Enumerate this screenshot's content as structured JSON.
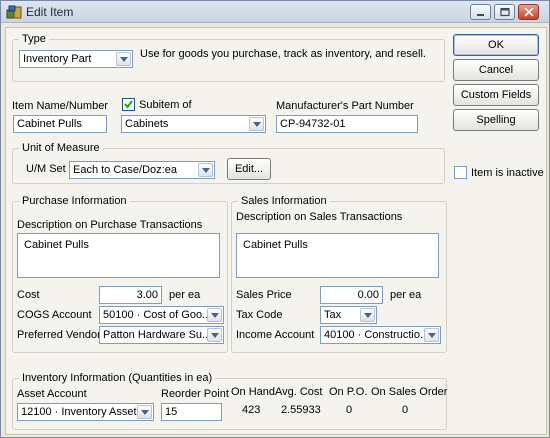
{
  "window": {
    "title": "Edit Item"
  },
  "type": {
    "legend": "Type",
    "selected": "Inventory Part",
    "description": "Use for goods you purchase, track as inventory, and resell."
  },
  "buttons": {
    "ok": "OK",
    "cancel": "Cancel",
    "custom_fields": "Custom Fields",
    "spelling": "Spelling",
    "edit": "Edit..."
  },
  "item": {
    "name_label": "Item Name/Number",
    "name_value": "Cabinet Pulls",
    "subitem_label": "Subitem of",
    "subitem_checked": true,
    "subitem_value": "Cabinets",
    "mfr_label": "Manufacturer's Part Number",
    "mfr_value": "CP-94732-01",
    "inactive_label": "Item is inactive",
    "inactive_checked": false
  },
  "uom": {
    "legend": "Unit of Measure",
    "set_label": "U/M Set",
    "set_value": "Each to Case/Doz:ea"
  },
  "purchase": {
    "legend": "Purchase Information",
    "desc_label": "Description on Purchase Transactions",
    "desc_value": "Cabinet Pulls",
    "cost_label": "Cost",
    "cost_value": "3.00",
    "cost_unit": "per ea",
    "cogs_label": "COGS Account",
    "cogs_value": "50100 · Cost of Goo...",
    "vendor_label": "Preferred Vendor",
    "vendor_value": "Patton Hardware Su..."
  },
  "sales": {
    "legend": "Sales Information",
    "desc_label": "Description on Sales Transactions",
    "desc_value": "Cabinet Pulls",
    "price_label": "Sales Price",
    "price_value": "0.00",
    "price_unit": "per ea",
    "tax_label": "Tax Code",
    "tax_value": "Tax",
    "income_label": "Income Account",
    "income_value": "40100 · Constructio..."
  },
  "inventory": {
    "legend": "Inventory Information (Quantities in ea)",
    "asset_label": "Asset Account",
    "asset_value": "12100 · Inventory Asset",
    "reorder_label": "Reorder Point",
    "reorder_value": "15",
    "on_hand_label": "On Hand",
    "on_hand_value": "423",
    "avg_cost_label": "Avg. Cost",
    "avg_cost_value": "2.55933",
    "on_po_label": "On P.O.",
    "on_po_value": "0",
    "on_sales_order_label": "On Sales Order",
    "on_sales_order_value": "0"
  }
}
